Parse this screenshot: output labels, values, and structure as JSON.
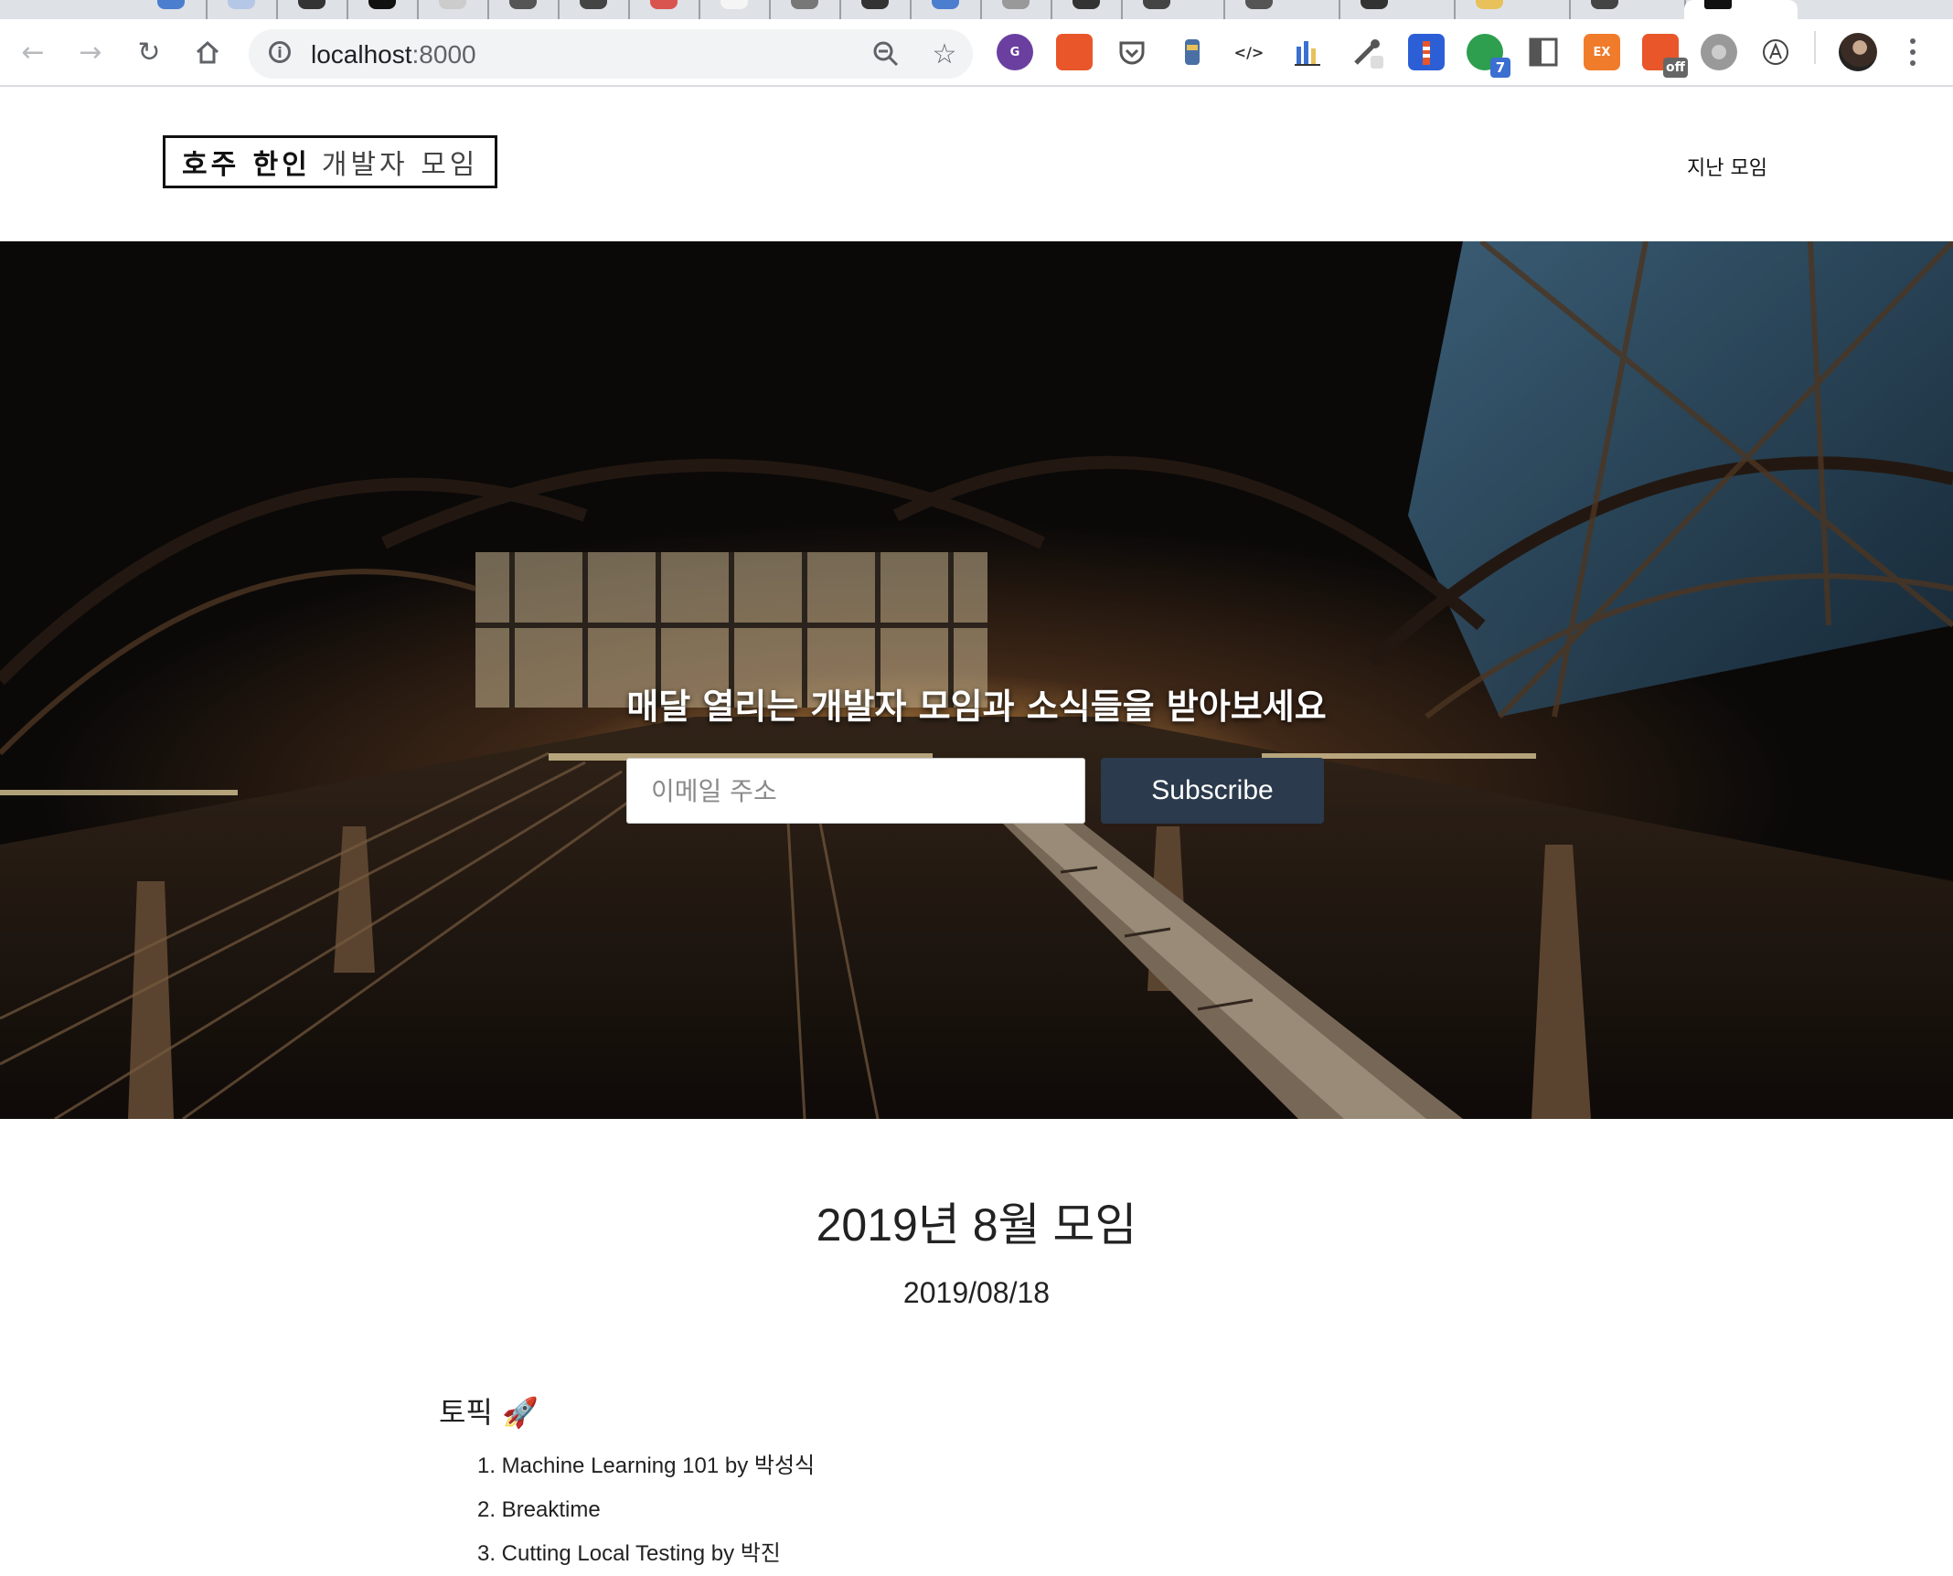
{
  "browser": {
    "url_host": "localhost",
    "url_port": ":8000",
    "extension_badges": {
      "count": "7",
      "off": "off",
      "ex": "EX"
    }
  },
  "site": {
    "logo_strong": "호주 한인",
    "logo_light": "개발자 모임",
    "nav_past_meetups": "지난 모임"
  },
  "hero": {
    "headline": "매달 열리는 개발자 모임과 소식들을 받아보세요",
    "email_placeholder": "이메일 주소",
    "subscribe_label": "Subscribe"
  },
  "event": {
    "title": "2019년 8월 모임",
    "date": "2019/08/18",
    "topics_heading": "토픽 🚀",
    "topics": [
      "1. Machine Learning 101 by 박성식",
      "2. Breaktime",
      "3. Cutting Local Testing by 박진"
    ]
  }
}
